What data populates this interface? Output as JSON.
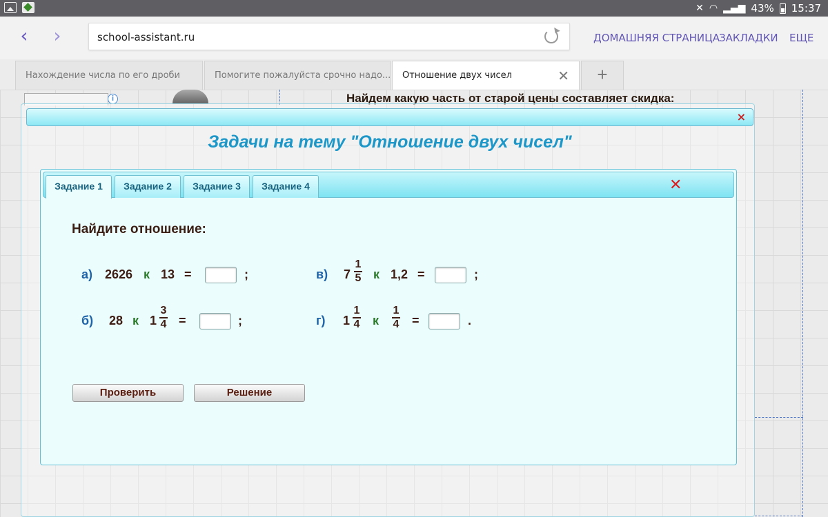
{
  "status_bar": {
    "battery_percent": "43%",
    "time": "15:37",
    "icons": [
      "image-icon",
      "gallery-icon",
      "mute-icon",
      "wifi-icon",
      "signal-icon",
      "battery-icon"
    ]
  },
  "browser": {
    "url": "school-assistant.ru",
    "links": {
      "home": "ДОМАШНЯЯ СТРАНИЦА",
      "bookmarks": "ЗАКЛАДКИ",
      "more": "ЕЩЕ"
    },
    "tabs": [
      {
        "title": "Нахождение числа по его дроби",
        "active": false
      },
      {
        "title": "Помогите пожалуйста срочно надо... - Ш...",
        "active": false
      },
      {
        "title": "Отношение двух чисел",
        "active": true
      }
    ],
    "close_glyph": "✕",
    "new_tab_glyph": "+"
  },
  "background_page": {
    "heading": "Найдем какую часть от старой цены составляет скидка:",
    "info_glyph": "i"
  },
  "modal": {
    "title": "Задачи на тему \"Отношение двух чисел\"",
    "close_glyph": "×",
    "tabs": [
      "Задание 1",
      "Задание 2",
      "Задание 3",
      "Задание 4"
    ],
    "panel_close_glyph": "✕",
    "instruction": "Найдите отношение:",
    "problems": {
      "a": {
        "label": "а)",
        "left": "2626",
        "k": "к",
        "right": "13",
        "eq": "=",
        "end": ";"
      },
      "b": {
        "label": "б)",
        "left": "28",
        "k": "к",
        "right_whole": "1",
        "right_num": "3",
        "right_den": "4",
        "eq": "=",
        "end": ";"
      },
      "v": {
        "label": "в)",
        "left_whole": "7",
        "left_num": "1",
        "left_den": "5",
        "k": "к",
        "right": "1,2",
        "eq": "=",
        "end": ";"
      },
      "g": {
        "label": "г)",
        "left_whole": "1",
        "left_num": "1",
        "left_den": "4",
        "k": "к",
        "right_num": "1",
        "right_den": "4",
        "eq": "=",
        "end": "."
      }
    },
    "buttons": {
      "check": "Проверить",
      "solution": "Решение"
    }
  },
  "colors": {
    "accent_title": "#1c97c8",
    "close_red": "#e01c1c",
    "k_green": "#2a7a2a",
    "label_blue": "#1f64a8",
    "text_brown": "#3e1e14"
  }
}
